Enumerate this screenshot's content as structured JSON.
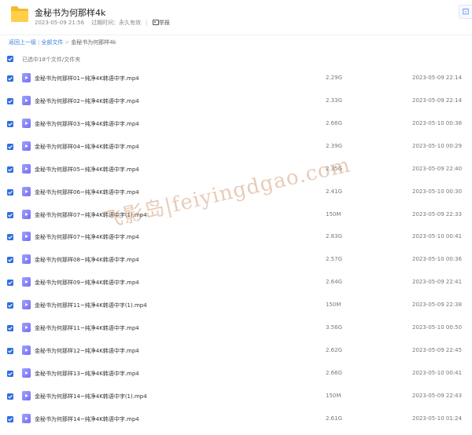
{
  "share": {
    "title": "金秘书为何那样4k",
    "date": "2023-05-09 21:56",
    "expiry_label": "过期时间：",
    "expiry_value": "永久有效",
    "report_label": "举报",
    "save_icon": "save-to-drive-icon"
  },
  "breadcrumb": {
    "back": "返回上一级",
    "all_files": "全部文件",
    "current": "金秘书为何那样4k"
  },
  "selection": {
    "text": "已选中18个文件/文件夹",
    "checkbox_color": "#2f6fdf"
  },
  "files": [
    {
      "name": "金秘书为何那样01~纯净4K韩语中字.mp4",
      "size": "2.29G",
      "date": "2023-05-09 22:14"
    },
    {
      "name": "金秘书为何那样02~纯净4K韩语中字.mp4",
      "size": "2.33G",
      "date": "2023-05-09 22:14"
    },
    {
      "name": "金秘书为何那样03~纯净4K韩语中字.mp4",
      "size": "2.66G",
      "date": "2023-05-10 00:38"
    },
    {
      "name": "金秘书为何那样04~纯净4K韩语中字.mp4",
      "size": "2.39G",
      "date": "2023-05-10 00:29"
    },
    {
      "name": "金秘书为何那样05~纯净4K韩语中字.mp4",
      "size": "2.35G",
      "date": "2023-05-09 22:40"
    },
    {
      "name": "金秘书为何那样06~纯净4K韩语中字.mp4",
      "size": "2.41G",
      "date": "2023-05-10 00:30"
    },
    {
      "name": "金秘书为何那样07~纯净4K韩语中字(1).mp4",
      "size": "150M",
      "date": "2023-05-09 22:33"
    },
    {
      "name": "金秘书为何那样07~纯净4K韩语中字.mp4",
      "size": "2.83G",
      "date": "2023-05-10 00:41"
    },
    {
      "name": "金秘书为何那样08~纯净4K韩语中字.mp4",
      "size": "2.57G",
      "date": "2023-05-10 00:36"
    },
    {
      "name": "金秘书为何那样09~纯净4K韩语中字.mp4",
      "size": "2.64G",
      "date": "2023-05-09 22:41"
    },
    {
      "name": "金秘书为何那样11~纯净4K韩语中字(1).mp4",
      "size": "150M",
      "date": "2023-05-09 22:38"
    },
    {
      "name": "金秘书为何那样11~纯净4K韩语中字.mp4",
      "size": "3.56G",
      "date": "2023-05-10 00:50"
    },
    {
      "name": "金秘书为何那样12~纯净4K韩语中字.mp4",
      "size": "2.62G",
      "date": "2023-05-09 22:45"
    },
    {
      "name": "金秘书为何那样13~纯净4K韩语中字.mp4",
      "size": "2.66G",
      "date": "2023-05-10 00:41"
    },
    {
      "name": "金秘书为何那样14~纯净4K韩语中字(1).mp4",
      "size": "150M",
      "date": "2023-05-09 22:43"
    },
    {
      "name": "金秘书为何那样14~纯净4K韩语中字.mp4",
      "size": "2.61G",
      "date": "2023-05-10 01:24"
    }
  ],
  "watermark": "飞影岛|feiyingdgao.com"
}
